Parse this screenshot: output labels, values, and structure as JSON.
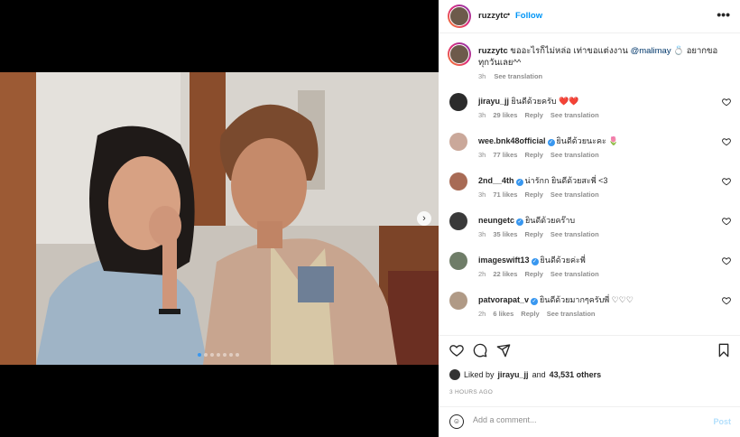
{
  "header": {
    "username": "ruzzytc",
    "separator": "•",
    "follow_label": "Follow",
    "more_icon": "more-horizontal-icon"
  },
  "caption": {
    "username": "ruzzytc",
    "text": "ขออะไรก็ไม่หล่อ เท่าขอแต่งงาน",
    "mention": "@malimay",
    "text_after": "💍 อยากขอทุกวันเลย^^",
    "time": "3h",
    "see_translation": "See translation"
  },
  "comments": [
    {
      "username": "jirayu_jj",
      "verified": false,
      "text": "ยินดีด้วยครับ ❤️❤️",
      "time": "3h",
      "likes": "29 likes",
      "reply": "Reply",
      "see_translation": "See translation",
      "avatar_color": "#2b2b2b"
    },
    {
      "username": "wee.bnk48official",
      "verified": true,
      "text": "ยินดีด้วยนะคะ 🌷",
      "time": "3h",
      "likes": "77 likes",
      "reply": "Reply",
      "see_translation": "See translation",
      "avatar_color": "#caa89a"
    },
    {
      "username": "2nd__4th",
      "verified": true,
      "text": "น่ารักก ยินดีด้วยสะพี่ <3",
      "time": "3h",
      "likes": "71 likes",
      "reply": "Reply",
      "see_translation": "See translation",
      "avatar_color": "#a86b55"
    },
    {
      "username": "neungetc",
      "verified": true,
      "text": "ยินดีด้วยคร๊าบ",
      "time": "3h",
      "likes": "35 likes",
      "reply": "Reply",
      "see_translation": "See translation",
      "avatar_color": "#3a3a3a"
    },
    {
      "username": "imageswift13",
      "verified": true,
      "text": "ยินดีด้วยค่ะพี่",
      "time": "2h",
      "likes": "22 likes",
      "reply": "Reply",
      "see_translation": "See translation",
      "avatar_color": "#6f7d68"
    },
    {
      "username": "patvorapat_v",
      "verified": true,
      "text": "ยินดีด้วยมากๆครับพี่ ♡♡♡",
      "time": "2h",
      "likes": "6 likes",
      "reply": "Reply",
      "see_translation": "See translation",
      "avatar_color": "#b09a86"
    }
  ],
  "comment_heart_icon": "heart-outline-icon",
  "actions": {
    "like_icon": "heart-outline-icon",
    "comment_icon": "speech-bubble-icon",
    "share_icon": "paper-plane-icon",
    "save_icon": "bookmark-icon"
  },
  "likes": {
    "prefix": "Liked by",
    "user": "jirayu_jj",
    "and": "and",
    "others": "43,531 others"
  },
  "time_ago": "3 HOURS AGO",
  "add_comment": {
    "placeholder": "Add a comment...",
    "post_label": "Post",
    "emoji_icon": "smiley-icon"
  },
  "carousel": {
    "next_icon": "chevron-right-icon",
    "slide_count": 7,
    "active_index": 0
  },
  "colors": {
    "link_blue": "#0095f6",
    "mention_blue": "#00376b",
    "post_disabled": "#b2dffc",
    "heart_red": "#ed4956"
  }
}
